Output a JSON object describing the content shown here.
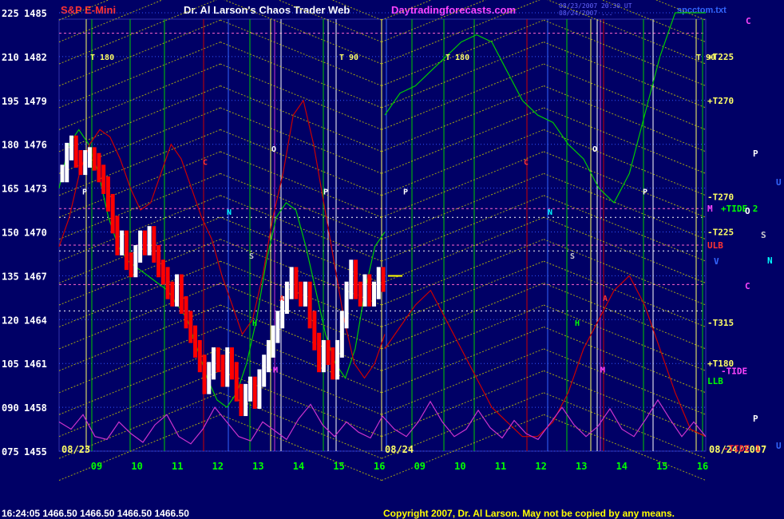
{
  "header": {
    "symbol": "S&P E-Mini",
    "title": "Dr. Al Larson's Chaos Trader Web",
    "site": "Daytradingforecasts.com",
    "timestamp_line1": "08/23/2007 20:30 UT",
    "timestamp_line2": "08/24/2007 ...",
    "file": "spcctom.txt"
  },
  "footer": {
    "quote": "16:24:05  1466.50 1466.50 1466.50 1466.50",
    "copyright": "Copyright 2007, Dr. Al Larson. May not be copied by any means."
  },
  "colors": {
    "background": "#000066",
    "grid_yellow": "#cccc00",
    "green_line": "#00cc00",
    "red_line": "#cc0000",
    "magenta_line": "#cc33cc",
    "white_bars": "#ffffff",
    "red_bars": "#ff0000"
  },
  "chart_data": {
    "type": "line",
    "title": "S&P E-Mini",
    "y_axis": {
      "range": [
        1455,
        1485
      ],
      "ticks": [
        {
          "left": "225",
          "price": "1485"
        },
        {
          "left": "210",
          "price": "1482"
        },
        {
          "left": "195",
          "price": "1479"
        },
        {
          "left": "180",
          "price": "1476"
        },
        {
          "left": "165",
          "price": "1473"
        },
        {
          "left": "150",
          "price": "1470"
        },
        {
          "left": "135",
          "price": "1467"
        },
        {
          "left": "120",
          "price": "1464"
        },
        {
          "left": "105",
          "price": "1461"
        },
        {
          "left": "090",
          "price": "1458"
        },
        {
          "left": "075",
          "price": "1455"
        }
      ]
    },
    "x_axis": {
      "ticks": [
        "09",
        "10",
        "11",
        "12",
        "13",
        "14",
        "15",
        "16",
        "09",
        "10",
        "11",
        "12",
        "13",
        "14",
        "15",
        "16"
      ],
      "dates": [
        "08/23",
        "08/24",
        "08/24/2007"
      ]
    },
    "price_path": [
      1474,
      1475.5,
      1476,
      1475,
      1474.5,
      1475,
      1475.2,
      1474.8,
      1474,
      1473.2,
      1472,
      1470.5,
      1469,
      1469.5,
      1468,
      1467.5,
      1468.5,
      1469.5,
      1469,
      1469.8,
      1468.5,
      1467.5,
      1467,
      1466,
      1465.5,
      1466.5,
      1465,
      1464,
      1463,
      1462,
      1461,
      1459.5,
      1460.5,
      1461.5,
      1461,
      1460,
      1461.5,
      1460.5,
      1459,
      1458,
      1459,
      1459.5,
      1458.5,
      1460,
      1461,
      1462,
      1463,
      1464,
      1465,
      1466,
      1467,
      1466,
      1465.5,
      1466,
      1464,
      1462.5,
      1461,
      1462,
      1461.5,
      1460.5,
      1462,
      1464,
      1466,
      1467.5,
      1466,
      1465.5,
      1466.5,
      1465.5,
      1466,
      1467,
      1466.5
    ],
    "green_curve_day1": [
      1473,
      1476,
      1477,
      1476,
      1474,
      1471,
      1469,
      1468,
      1467.5,
      1467,
      1466.5,
      1466,
      1465,
      1464,
      1462,
      1460,
      1458.5,
      1458,
      1459,
      1461,
      1464,
      1468,
      1471,
      1472,
      1471.5,
      1469,
      1466,
      1463,
      1461,
      1460,
      1462,
      1466,
      1469,
      1470
    ],
    "green_curve_day2": [
      1478,
      1479.5,
      1480,
      1481,
      1482,
      1483,
      1483.5,
      1483,
      1481,
      1479,
      1478,
      1477.5,
      1476,
      1475,
      1473,
      1472,
      1474,
      1478,
      1482,
      1485,
      1485,
      1485
    ],
    "red_curve_day1": [
      1469,
      1471,
      1474,
      1476,
      1477,
      1476.5,
      1475,
      1473,
      1471.5,
      1472,
      1474,
      1476,
      1475,
      1473,
      1471,
      1469.5,
      1467,
      1465,
      1463,
      1464,
      1467,
      1471,
      1474,
      1478,
      1479,
      1476,
      1472,
      1468,
      1464,
      1461,
      1460,
      1461,
      1463
    ],
    "red_curve_day2": [
      1462,
      1463.5,
      1465,
      1466,
      1464,
      1462,
      1460,
      1458,
      1457,
      1456,
      1456,
      1457,
      1459,
      1462,
      1464,
      1466,
      1467,
      1465,
      1462,
      1459,
      1456.5,
      1456
    ],
    "magenta_wave": [
      1457,
      1456.5,
      1457.5,
      1456,
      1455.8,
      1457,
      1456.2,
      1455.6,
      1456.8,
      1457.5,
      1456,
      1455.5,
      1456.5,
      1458,
      1457,
      1456,
      1455.7,
      1457,
      1456.4,
      1455.8,
      1457.2,
      1458.2,
      1456.8,
      1456,
      1457,
      1456.3,
      1455.9,
      1457.4,
      1456.5,
      1456,
      1457,
      1458.4,
      1457,
      1456,
      1456.5,
      1457.8,
      1456.6,
      1455.9,
      1457.1,
      1456.2,
      1455.8,
      1456.9,
      1458,
      1456.8,
      1456,
      1456.7,
      1457.9,
      1456.5,
      1456,
      1457.2,
      1458.5,
      1457.2,
      1456,
      1457,
      1456
    ],
    "left_labels": [
      {
        "text": "T 180",
        "price": 1482
      },
      {
        "text": "T 90",
        "price": 1482
      },
      {
        "text": "T 180",
        "price": 1482
      },
      {
        "text": "T 90",
        "price": 1482
      },
      {
        "text": "P",
        "price": 1472.8
      },
      {
        "text": "O",
        "price": 1475.7
      },
      {
        "text": "P",
        "price": 1472.8
      },
      {
        "text": "P",
        "price": 1472.8
      },
      {
        "text": "O",
        "price": 1475.7
      },
      {
        "text": "P",
        "price": 1472.8
      },
      {
        "text": "C",
        "price": 1474.8
      },
      {
        "text": "C",
        "price": 1474.8
      },
      {
        "text": "N",
        "price": 1471.4
      },
      {
        "text": "N",
        "price": 1471.4
      },
      {
        "text": "S",
        "price": 1468.4
      },
      {
        "text": "S",
        "price": 1468.4
      },
      {
        "text": "H",
        "price": 1463.8
      },
      {
        "text": "H",
        "price": 1463.8
      },
      {
        "text": "M",
        "price": 1460.6
      },
      {
        "text": "M",
        "price": 1460.6
      },
      {
        "text": "A",
        "price": 1465.5
      },
      {
        "text": "A",
        "price": 1465.5
      }
    ],
    "right_labels": [
      {
        "text": "+T225",
        "price": 1482,
        "color": "#ffff66"
      },
      {
        "text": "+T270",
        "price": 1479,
        "color": "#ffff66"
      },
      {
        "text": "-T270",
        "price": 1472.4,
        "color": "#ffff66"
      },
      {
        "text": "M",
        "price": 1471.6,
        "color": "#ff44ff"
      },
      {
        "text": "+TIDE 2",
        "price": 1471.6,
        "color": "#00ff00"
      },
      {
        "text": "-T225",
        "price": 1470,
        "color": "#ffff66"
      },
      {
        "text": "ULB",
        "price": 1469.1,
        "color": "#ff3333"
      },
      {
        "text": "V",
        "price": 1468,
        "color": "#3366ff"
      },
      {
        "text": "-T315",
        "price": 1463.8,
        "color": "#ffff66"
      },
      {
        "text": "+T180",
        "price": 1461,
        "color": "#ffff66"
      },
      {
        "text": "-TIDE",
        "price": 1460.5,
        "color": "#ff44ff"
      },
      {
        "text": "LLB",
        "price": 1459.8,
        "color": "#00ff00"
      },
      {
        "text": "-TIDE 1",
        "price": 1455.2,
        "color": "#ff3333"
      }
    ],
    "far_right_labels": [
      {
        "text": "C",
        "color": "#ff44ff"
      },
      {
        "text": "P",
        "color": "#ffffff"
      },
      {
        "text": "U",
        "color": "#3366ff"
      },
      {
        "text": "O",
        "color": "#ffffff"
      },
      {
        "text": "S",
        "color": "#cccccc"
      },
      {
        "text": "N",
        "color": "#00ffff"
      },
      {
        "text": "C",
        "color": "#ff44ff"
      },
      {
        "text": "P",
        "color": "#ffffff"
      },
      {
        "text": "U",
        "color": "#3366ff"
      }
    ],
    "last_price": 1466.5
  }
}
